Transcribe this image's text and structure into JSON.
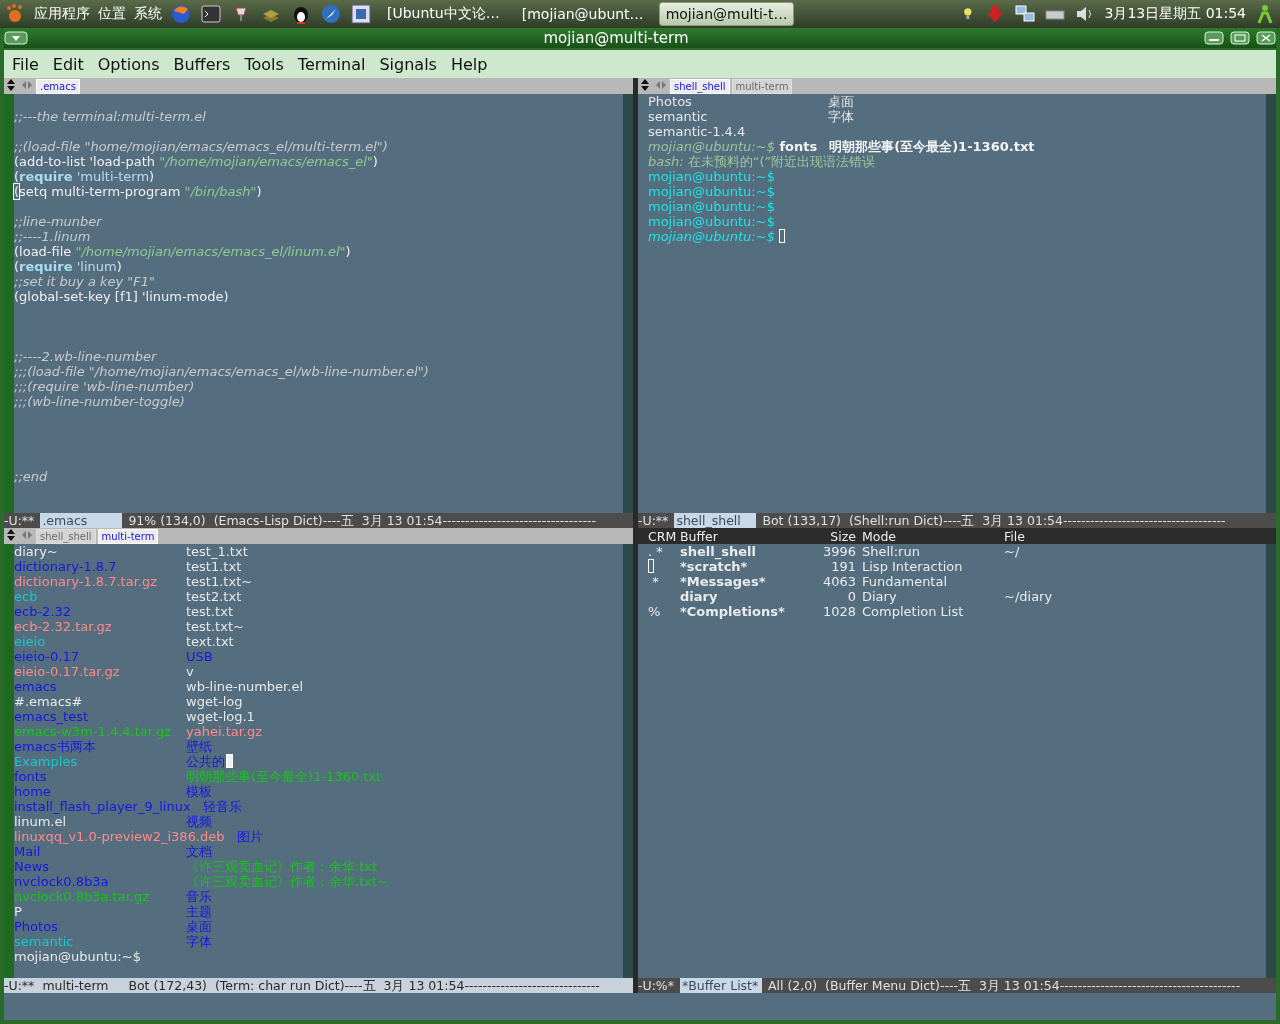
{
  "top_panel": {
    "menus": [
      "应用程序",
      "位置",
      "系统"
    ],
    "tasks": [
      {
        "label": "[Ubuntu中文论…",
        "selected": false
      },
      {
        "label": "[mojian@ubunt…",
        "selected": false
      },
      {
        "label": "mojian@multi-t…",
        "selected": true
      }
    ],
    "clock": "3月13日星期五 01:54"
  },
  "window": {
    "title": "mojian@multi-term"
  },
  "menu_bar": [
    "File",
    "Edit",
    "Options",
    "Buffers",
    "Tools",
    "Terminal",
    "Signals",
    "Help"
  ],
  "panes": [
    {
      "kind": "code",
      "tabs": [
        {
          "label": ".emacs",
          "selected": true
        }
      ],
      "lines": [
        {
          "kind": "blank"
        },
        {
          "kind": "code",
          "segments": [
            {
              "text": ";;---the terminal:multi-term.el",
              "kind": "comment"
            }
          ]
        },
        {
          "kind": "blank"
        },
        {
          "kind": "code",
          "segments": [
            {
              "text": ";;(load-file \"home/mojian/emacs/emacs_el/multi-term.el\")",
              "kind": "comment"
            }
          ]
        },
        {
          "kind": "code",
          "segments": [
            {
              "text": "(add-to-list 'load-path ",
              "kind": "normal"
            },
            {
              "text": "\"/home/mojian/emacs/emacs_el\"",
              "kind": "string"
            },
            {
              "text": ")",
              "kind": "normal"
            }
          ]
        },
        {
          "kind": "code",
          "segments": [
            {
              "text": "(",
              "kind": "normal"
            },
            {
              "text": "require",
              "kind": "keyword"
            },
            {
              "text": " 'multi-term",
              "kind": "symbol"
            },
            {
              "text": ")",
              "kind": "normal"
            }
          ]
        },
        {
          "kind": "code",
          "segments": [
            {
              "text": "(",
              "kind": "normal",
              "cursor": true
            },
            {
              "text": "setq multi-term-program ",
              "kind": "normal"
            },
            {
              "text": "\"/bin/bash\"",
              "kind": "string"
            },
            {
              "text": ")",
              "kind": "normal"
            }
          ]
        },
        {
          "kind": "blank"
        },
        {
          "kind": "code",
          "segments": [
            {
              "text": ";;line-munber",
              "kind": "comment"
            }
          ]
        },
        {
          "kind": "code",
          "segments": [
            {
              "text": ";;----1.linum",
              "kind": "comment"
            }
          ]
        },
        {
          "kind": "code",
          "segments": [
            {
              "text": "(load-file ",
              "kind": "normal"
            },
            {
              "text": "\"/home/mojian/emacs/emacs_el/linum.el\"",
              "kind": "string"
            },
            {
              "text": ")",
              "kind": "normal"
            }
          ]
        },
        {
          "kind": "code",
          "segments": [
            {
              "text": "(",
              "kind": "normal"
            },
            {
              "text": "require",
              "kind": "keyword"
            },
            {
              "text": " 'linum",
              "kind": "symbol"
            },
            {
              "text": ")",
              "kind": "normal"
            }
          ]
        },
        {
          "kind": "code",
          "segments": [
            {
              "text": ";;set it buy a key \"F1\"",
              "kind": "comment"
            }
          ]
        },
        {
          "kind": "code",
          "segments": [
            {
              "text": "(global-set-key [f1] 'linum-mode)",
              "kind": "normal"
            }
          ]
        },
        {
          "kind": "blank"
        },
        {
          "kind": "blank"
        },
        {
          "kind": "blank"
        },
        {
          "kind": "code",
          "segments": [
            {
              "text": ";;----2.wb-line-number",
              "kind": "comment"
            }
          ]
        },
        {
          "kind": "code",
          "segments": [
            {
              "text": ";;;(load-file \"/home/mojian/emacs/emacs_el/wb-line-number.el\")",
              "kind": "comment"
            }
          ]
        },
        {
          "kind": "code",
          "segments": [
            {
              "text": ";;;(require 'wb-line-number)",
              "kind": "comment"
            }
          ]
        },
        {
          "kind": "code",
          "segments": [
            {
              "text": ";;;(wb-line-number-toggle)",
              "kind": "comment"
            }
          ]
        },
        {
          "kind": "blank"
        },
        {
          "kind": "blank"
        },
        {
          "kind": "blank"
        },
        {
          "kind": "blank"
        },
        {
          "kind": "code",
          "segments": [
            {
              "text": ";;end",
              "kind": "comment"
            }
          ]
        }
      ],
      "mode_line": {
        "status": "-U:**",
        "buffer": ".emacs",
        "buffer_highlighted": true,
        "position": "91% (134,0)",
        "modes": "(Emacs-Lisp Dict)----五  3月 13 01:54",
        "fill": "----------------------------------",
        "active": false
      }
    },
    {
      "kind": "terminal",
      "tabs": [
        {
          "label": "shell_shell",
          "selected": true
        },
        {
          "label": "multi-term",
          "selected": false
        }
      ],
      "lines": [
        {
          "segments": [
            {
              "text": "Photos",
              "kind": "plain"
            }
          ],
          "column_2": [
            {
              "text": "桌面",
              "kind": "plain"
            }
          ]
        },
        {
          "segments": [
            {
              "text": "semantic",
              "kind": "plain"
            }
          ],
          "column_2": [
            {
              "text": "字体",
              "kind": "plain"
            }
          ]
        },
        {
          "segments": [
            {
              "text": "semantic-1.4.4",
              "kind": "plain"
            }
          ]
        },
        {
          "segments": [
            {
              "text": "mojian@ubuntu:~$",
              "kind": "dim-italic"
            },
            {
              "text": " fonts",
              "kind": "bold"
            }
          ],
          "column_2": [
            {
              "text": "明朝那些事(至今最全)1-1360.txt",
              "kind": "bold"
            }
          ]
        },
        {
          "segments": [
            {
              "text": "bash:",
              "kind": "dim-italic"
            },
            {
              "text": " 在未预料的“(”附近出现语法错误",
              "kind": "dim"
            }
          ]
        },
        {
          "segments": [
            {
              "text": "mojian@ubuntu:~$",
              "kind": "prompt"
            }
          ]
        },
        {
          "segments": [
            {
              "text": "mojian@ubuntu:~$",
              "kind": "prompt"
            }
          ]
        },
        {
          "segments": [
            {
              "text": "mojian@ubuntu:~$",
              "kind": "prompt"
            }
          ]
        },
        {
          "segments": [
            {
              "text": "mojian@ubuntu:~$",
              "kind": "prompt"
            }
          ]
        },
        {
          "segments": [
            {
              "text": "mojian@ubuntu:~$ ",
              "kind": "prompt-italic",
              "cursor": true
            }
          ]
        }
      ],
      "mode_line": {
        "status": "-U:**",
        "buffer": "shell_shell",
        "buffer_highlighted": true,
        "position": "Bot (133,17)",
        "modes": "(Shell:run Dict)----五  3月 13 01:54",
        "fill": "------------------------------------",
        "active": false
      }
    },
    {
      "kind": "listing",
      "tabs": [
        {
          "label": "shell_shell",
          "selected": false
        },
        {
          "label": "multi-term",
          "selected": true
        }
      ],
      "rows": [
        {
          "column_1": {
            "text": "diary~",
            "kind": "file"
          },
          "column_2": {
            "text": "test_1.txt",
            "kind": "file"
          }
        },
        {
          "column_1": {
            "text": "dictionary-1.8.7",
            "kind": "dir"
          },
          "column_2": {
            "text": "test1.txt",
            "kind": "file"
          }
        },
        {
          "column_1": {
            "text": "dictionary-1.8.7.tar.gz",
            "kind": "archive"
          },
          "column_2": {
            "text": "test1.txt~",
            "kind": "file"
          }
        },
        {
          "column_1": {
            "text": "ecb",
            "kind": "link"
          },
          "column_2": {
            "text": "test2.txt",
            "kind": "file"
          }
        },
        {
          "column_1": {
            "text": "ecb-2.32",
            "kind": "dir"
          },
          "column_2": {
            "text": "test.txt",
            "kind": "file"
          }
        },
        {
          "column_1": {
            "text": "ecb-2.32.tar.gz",
            "kind": "archive"
          },
          "column_2": {
            "text": "test.txt~",
            "kind": "file"
          }
        },
        {
          "column_1": {
            "text": "eieio",
            "kind": "link"
          },
          "column_2": {
            "text": "text.txt",
            "kind": "file"
          }
        },
        {
          "column_1": {
            "text": "eieio-0.17",
            "kind": "dir"
          },
          "column_2": {
            "text": "USB",
            "kind": "dir"
          }
        },
        {
          "column_1": {
            "text": "eieio-0.17.tar.gz",
            "kind": "archive"
          },
          "column_2": {
            "text": "v",
            "kind": "file"
          }
        },
        {
          "column_1": {
            "text": "emacs",
            "kind": "dir"
          },
          "column_2": {
            "text": "wb-line-number.el",
            "kind": "file"
          }
        },
        {
          "column_1": {
            "text": "#.emacs#",
            "kind": "file"
          },
          "column_2": {
            "text": "wget-log",
            "kind": "file"
          }
        },
        {
          "column_1": {
            "text": "emacs_test",
            "kind": "dir"
          },
          "column_2": {
            "text": "wget-log.1",
            "kind": "file"
          }
        },
        {
          "column_1": {
            "text": "emacs-w3m-1.4.4.tar.gz",
            "kind": "exec"
          },
          "column_2": {
            "text": "yahei.tar.gz",
            "kind": "archive"
          }
        },
        {
          "column_1": {
            "text": "emacs书两本",
            "kind": "dir"
          },
          "column_2": {
            "text": "壁纸",
            "kind": "dir"
          }
        },
        {
          "column_1": {
            "text": "Examples",
            "kind": "link"
          },
          "column_2": {
            "text": "公共的",
            "kind": "dir",
            "cursor": true
          }
        },
        {
          "column_1": {
            "text": "fonts",
            "kind": "dir"
          },
          "column_2": {
            "text": "明朝那些事(至今最全)1-1360.txt",
            "kind": "exec"
          }
        },
        {
          "column_1": {
            "text": "home",
            "kind": "dir"
          },
          "column_2": {
            "text": "模板",
            "kind": "dir"
          }
        },
        {
          "column_1": {
            "text": "install_flash_player_9_linux",
            "kind": "dir"
          },
          "column_2": {
            "text": "轻音乐",
            "kind": "dir"
          }
        },
        {
          "column_1": {
            "text": "linum.el",
            "kind": "file"
          },
          "column_2": {
            "text": "视频",
            "kind": "dir"
          }
        },
        {
          "column_1": {
            "text": "linuxqq_v1.0-preview2_i386.deb",
            "kind": "archive"
          },
          "column_2": {
            "text": "图片",
            "kind": "dir"
          }
        },
        {
          "column_1": {
            "text": "Mail",
            "kind": "dir"
          },
          "column_2": {
            "text": "文档",
            "kind": "dir"
          }
        },
        {
          "column_1": {
            "text": "News",
            "kind": "dir"
          },
          "column_2": {
            "text": "《许三观卖血记》作者：余华.txt",
            "kind": "exec"
          }
        },
        {
          "column_1": {
            "text": "nvclock0.8b3a",
            "kind": "dir"
          },
          "column_2": {
            "text": "《许三观卖血记》作者：余华.txt~",
            "kind": "exec"
          }
        },
        {
          "column_1": {
            "text": "nvclock0.8b3a.tar.gz",
            "kind": "exec"
          },
          "column_2": {
            "text": "音乐",
            "kind": "dir"
          }
        },
        {
          "column_1": {
            "text": "P",
            "kind": "file"
          },
          "column_2": {
            "text": "主题",
            "kind": "dir"
          }
        },
        {
          "column_1": {
            "text": "Photos",
            "kind": "dir"
          },
          "column_2": {
            "text": "桌面",
            "kind": "dir"
          }
        },
        {
          "column_1": {
            "text": "semantic",
            "kind": "link"
          },
          "column_2": {
            "text": "字体",
            "kind": "dir"
          }
        }
      ],
      "prompt": "mojian@ubuntu:~$",
      "mode_line": {
        "status": "-U:**",
        "buffer": "multi-term",
        "buffer_highlighted": false,
        "position": "Bot (172,43)",
        "modes": "(Term: char run Dict)----五  3月 13 01:54",
        "fill": "------------------------------",
        "active": true
      }
    },
    {
      "kind": "buffer_list",
      "header": {
        "crm": "CRM",
        "buffer": "Buffer",
        "size": "Size",
        "mode": "Mode",
        "file": "File"
      },
      "rows": [
        {
          "crm": ". *",
          "name": "shell_shell",
          "size": "3996",
          "mode": "Shell:run",
          "file": "~/"
        },
        {
          "cursor": true,
          "name": "*scratch*",
          "size": "191",
          "mode": "Lisp Interaction"
        },
        {
          "crm": " *",
          "name": "*Messages*",
          "size": "4063",
          "mode": "Fundamental"
        },
        {
          "name": "diary",
          "size": "0",
          "mode": "Diary",
          "file": "~/diary"
        },
        {
          "crm": "%",
          "name": "*Completions*",
          "size": "1028",
          "mode": "Completion List"
        }
      ],
      "mode_line": {
        "status": "-U:%*",
        "buffer": "*Buffer List*",
        "buffer_highlighted": true,
        "position": "All (2,0)",
        "modes": "(Buffer Menu Dict)----五  3月 13 01:54",
        "fill": "----------------------------------------",
        "active": false
      }
    }
  ]
}
